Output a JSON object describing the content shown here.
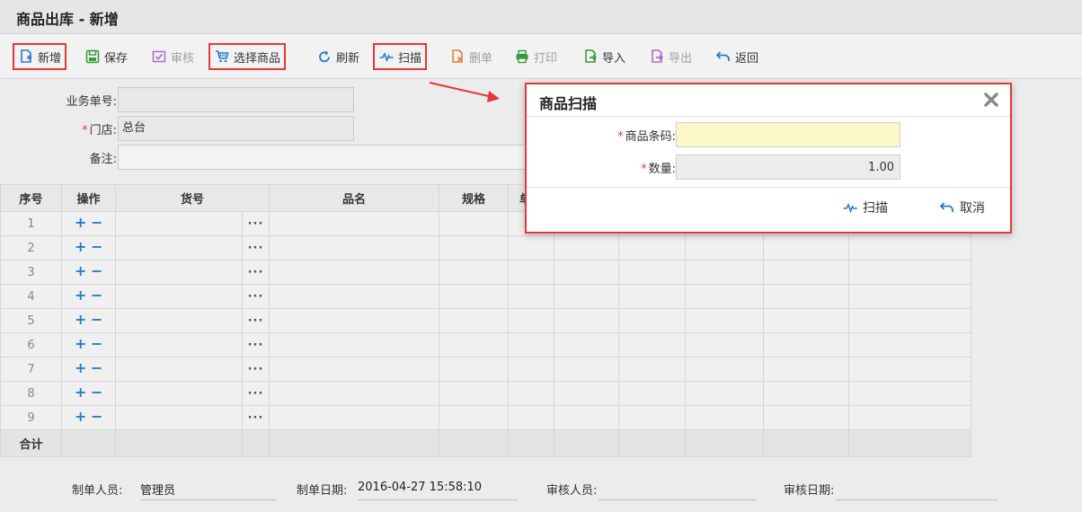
{
  "page": {
    "title": "商品出库 - 新增"
  },
  "toolbar": {
    "new": "新增",
    "save": "保存",
    "audit": "审核",
    "select_goods": "选择商品",
    "refresh": "刷新",
    "scan": "扫描",
    "delete": "删单",
    "print": "打印",
    "import": "导入",
    "export": "导出",
    "back": "返回"
  },
  "form": {
    "doc_no_label": "业务单号:",
    "doc_no_value": "",
    "store_label": "门店:",
    "store_value": "总台",
    "remark_label": "备注:",
    "remark_value": ""
  },
  "grid": {
    "headers": [
      "序号",
      "操作",
      "货号",
      "品名",
      "规格",
      "单"
    ],
    "rows": [
      "1",
      "2",
      "3",
      "4",
      "5",
      "6",
      "7",
      "8",
      "9"
    ],
    "total_label": "合计",
    "add_symbol": "+",
    "remove_symbol": "−",
    "more_symbol": "···"
  },
  "footer": {
    "creator_label": "制单人员:",
    "creator_value": "管理员",
    "create_date_label": "制单日期:",
    "create_date_value": "2016-04-27 15:58:10",
    "auditor_label": "审核人员:",
    "auditor_value": "",
    "audit_date_label": "审核日期:",
    "audit_date_value": ""
  },
  "dialog": {
    "title": "商品扫描",
    "barcode_label": "商品条码:",
    "barcode_value": "",
    "qty_label": "数量:",
    "qty_value": "1.00",
    "scan_button": "扫描",
    "cancel_button": "取消"
  },
  "colors": {
    "highlight": "#e53935",
    "accent_blue": "#2a7ad4",
    "icon_green": "#3a9a3a",
    "icon_purple": "#b06ad0"
  }
}
